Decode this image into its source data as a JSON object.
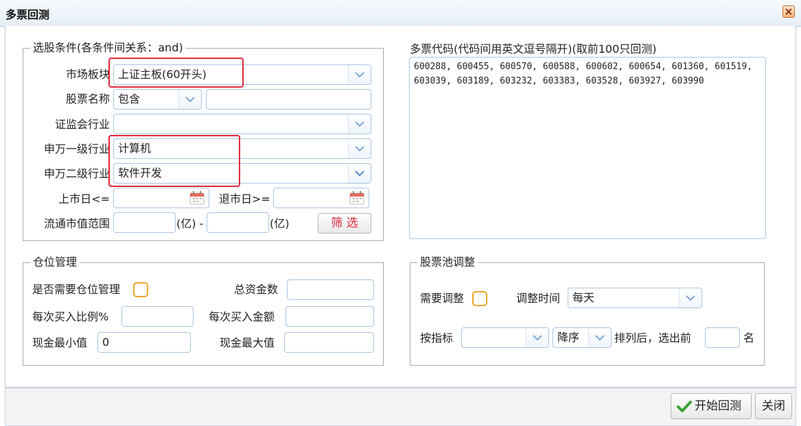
{
  "window": {
    "title": "多票回测"
  },
  "conditions": {
    "legend": "选股条件(各条件间关系：and)",
    "market_label": "市场板块",
    "market_value": "上证主板(60开头)",
    "name_label": "股票名称",
    "name_mode": "包含",
    "name_value": "",
    "csrc_label": "证监会行业",
    "csrc_value": "",
    "sw1_label": "申万一级行业",
    "sw1_value": "计算机",
    "sw2_label": "申万二级行业",
    "sw2_value": "软件开发",
    "list_date_label": "上市日<=",
    "list_date_value": "",
    "delist_date_label": "退市日>=",
    "delist_date_value": "",
    "mcap_label": "流通市值范围",
    "mcap_min": "",
    "mcap_unit1": "(亿) -",
    "mcap_max": "",
    "mcap_unit2": "(亿)",
    "filter_button": "筛 选"
  },
  "codes": {
    "label": "多票代码(代码间用英文逗号隔开)(取前100只回测)",
    "value": "600288, 600455, 600570, 600588, 600602, 600654, 601360, 601519, 603039, 603189, 603232, 603383, 603528, 603927, 603990"
  },
  "position": {
    "legend": "仓位管理",
    "need_label": "是否需要仓位管理",
    "need_checked": false,
    "total_label": "总资金数",
    "total_value": "",
    "ratio_label": "每次买入比例%",
    "ratio_value": "",
    "amount_label": "每次买入金额",
    "amount_value": "",
    "cash_min_label": "现金最小值",
    "cash_min_value": "0",
    "cash_max_label": "现金最大值",
    "cash_max_value": ""
  },
  "pool": {
    "legend": "股票池调整",
    "need_label": "需要调整",
    "need_checked": false,
    "time_label": "调整时间",
    "time_value": "每天",
    "indicator_label": "按指标",
    "indicator_value": "",
    "order_value": "降序",
    "sort_text": "排列后，选出前",
    "top_n_value": "",
    "unit": "名"
  },
  "footer": {
    "start_button": "开始回测",
    "close_button": "关闭"
  },
  "colors": {
    "highlight": "#e0283a",
    "checkbox_border": "#f0a42c",
    "filter_text": "#e0283a",
    "check_icon": "#3aa23a"
  },
  "icons": [
    "close-icon",
    "chevron-down-icon",
    "calendar-icon",
    "checkmark-icon"
  ]
}
